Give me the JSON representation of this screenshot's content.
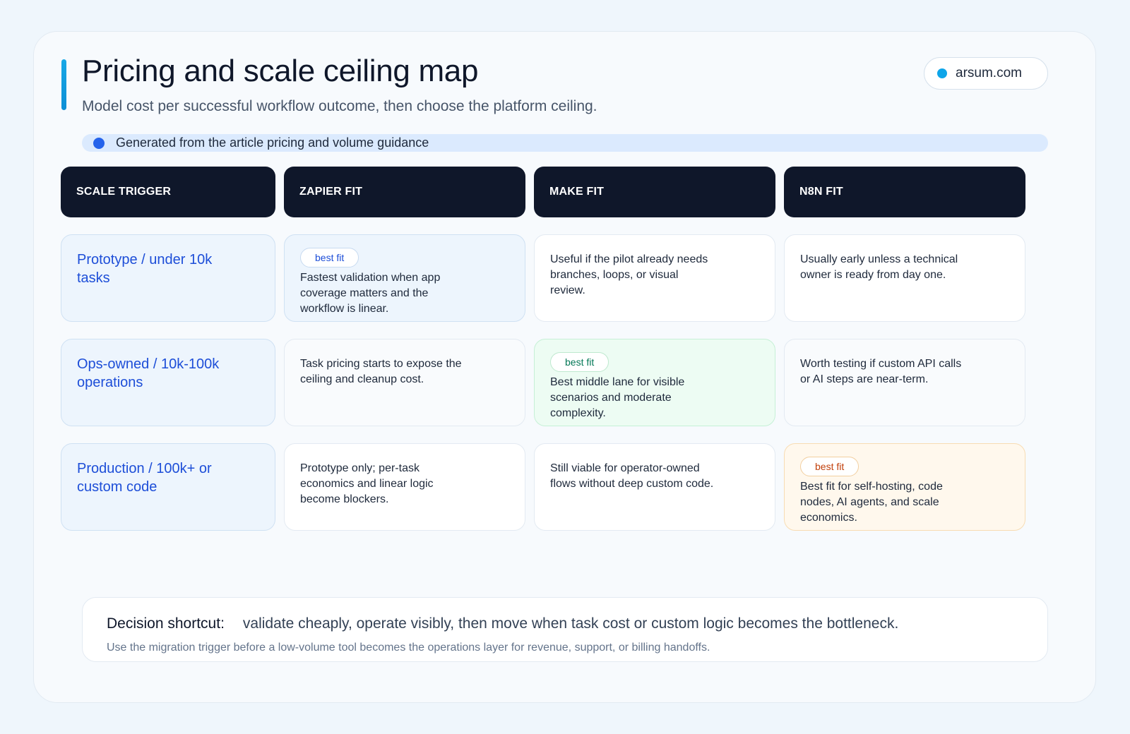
{
  "header": {
    "title": "Pricing and scale ceiling map",
    "subtitle": "Model cost per successful workflow outcome, then choose the platform ceiling.",
    "domain": "arsum.com",
    "source_note": "Generated from the article pricing and volume guidance"
  },
  "table": {
    "columns": [
      "SCALE TRIGGER",
      "ZAPIER FIT",
      "MAKE FIT",
      "N8N FIT"
    ],
    "rows": [
      {
        "trigger": "Prototype / under 10k tasks",
        "zapier": "Fastest validation when app coverage matters and the workflow is linear.",
        "make": "Useful if the pilot already needs branches, loops, or visual review.",
        "n8n": "Usually early unless a technical owner is ready from day one."
      },
      {
        "trigger": "Ops-owned / 10k-100k operations",
        "zapier": "Task pricing starts to expose the ceiling and cleanup cost.",
        "make": "Best middle lane for visible scenarios and moderate complexity.",
        "n8n": "Worth testing if custom API calls or AI steps are near-term."
      },
      {
        "trigger": "Production / 100k+ or custom code",
        "zapier": "Prototype only; per-task economics and linear logic become blockers.",
        "make": "Still viable for operator-owned flows without deep custom code.",
        "n8n": "Best fit for self-hosting, code nodes, AI agents, and scale economics."
      }
    ],
    "best_fit_label": "best fit"
  },
  "footer": {
    "label": "Decision shortcut:",
    "message": "validate cheaply, operate visibly, then move when task cost or custom logic becomes the bottleneck.",
    "note": "Use the migration trigger before a low-volume tool becomes the operations layer for revenue, support, or billing handoffs."
  },
  "colors": {
    "accent": "#0ea5e9",
    "header_bg": "#0f172a",
    "trigger_text": "#1d4ed8",
    "best_blue": "#edf5fd",
    "best_green": "#edfcf3",
    "best_orange": "#fff8ed"
  },
  "icons": [
    "status-dot-icon",
    "info-dot-icon"
  ]
}
